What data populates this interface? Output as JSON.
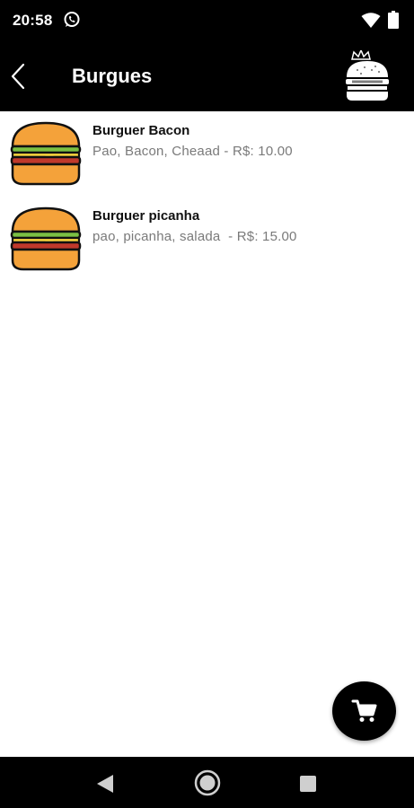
{
  "status_bar": {
    "time": "20:58",
    "icons": [
      "whatsapp-icon",
      "wifi-icon",
      "battery-icon"
    ]
  },
  "app_bar": {
    "title": "Burgues",
    "back_icon": "chevron-left-icon",
    "logo_icon": "burger-king-logo-icon"
  },
  "products": [
    {
      "name": "Burguer Bacon",
      "description": "Pao, Bacon, Cheaad - R$: 10.00",
      "icon": "burger-icon"
    },
    {
      "name": "Burguer picanha",
      "description": "pao, picanha, salada  - R$: 15.00",
      "icon": "burger-icon"
    }
  ],
  "fab": {
    "icon": "cart-icon"
  },
  "nav_bar": {
    "icons": [
      "nav-back-icon",
      "nav-home-icon",
      "nav-recents-icon"
    ]
  },
  "colors": {
    "bar_background": "#000000",
    "bun": "#F4A23A",
    "lettuce": "#7BC043",
    "cheese": "#F9D53E",
    "patty": "#C0392B",
    "description_text": "#7a7a7a"
  }
}
